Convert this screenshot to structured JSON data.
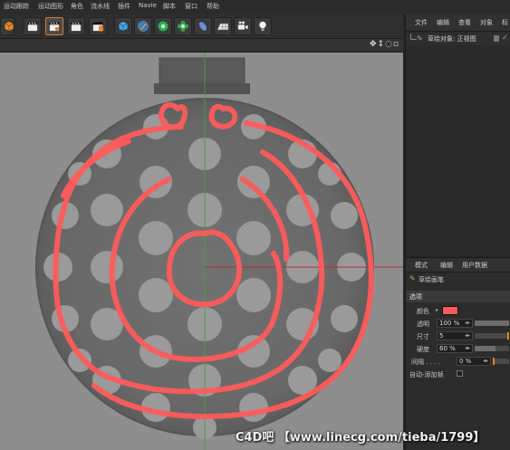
{
  "menubar": {
    "items": [
      "运动跟踪",
      "运动图形",
      "角色",
      "流水线",
      "插件",
      "Navie",
      "脚本",
      "窗口",
      "帮助"
    ]
  },
  "toolbar": {
    "icons": [
      "cube-icon",
      "clapper-icon",
      "clapper-active-icon",
      "clapper-icon",
      "clapper-cube-icon",
      "cube-blue-icon",
      "pen-icon",
      "green-gear-icon",
      "green-flower-icon",
      "blue-capsule-icon",
      "floor-grid-icon",
      "camera-icon",
      "light-bulb-icon"
    ]
  },
  "viewport": {
    "header_icons": "✥↕◌▫"
  },
  "object_manager": {
    "menu": [
      "文件",
      "编辑",
      "查看",
      "对象",
      "标"
    ],
    "row_label": "草绘对象: 正视图"
  },
  "attribute_manager": {
    "menu": [
      "模式",
      "编辑",
      "用户数据"
    ],
    "title": "草绘画笔",
    "section": "选项",
    "props": {
      "color_label": "颜色",
      "opacity_label": "透明",
      "opacity_value": "100 %",
      "size_label": "尺寸",
      "size_value": "5",
      "hardness_label": "硬度",
      "hardness_value": "60 %",
      "spacing_label": "间隔 . . . .",
      "spacing_value": "0 %",
      "autokey_label": "自动-添加帧"
    },
    "color": "#ff5b5b",
    "opacity_fraction": 1.0,
    "hardness_fraction": 0.6,
    "spacing_fraction": 0.0
  },
  "watermark": "C4D吧 【www.linecg.com/tieba/1799】",
  "colors": {
    "sketch": "#ff5b5b",
    "accent": "#e07a2e",
    "axis_green": "#3fa33f",
    "axis_red": "#b03030"
  }
}
